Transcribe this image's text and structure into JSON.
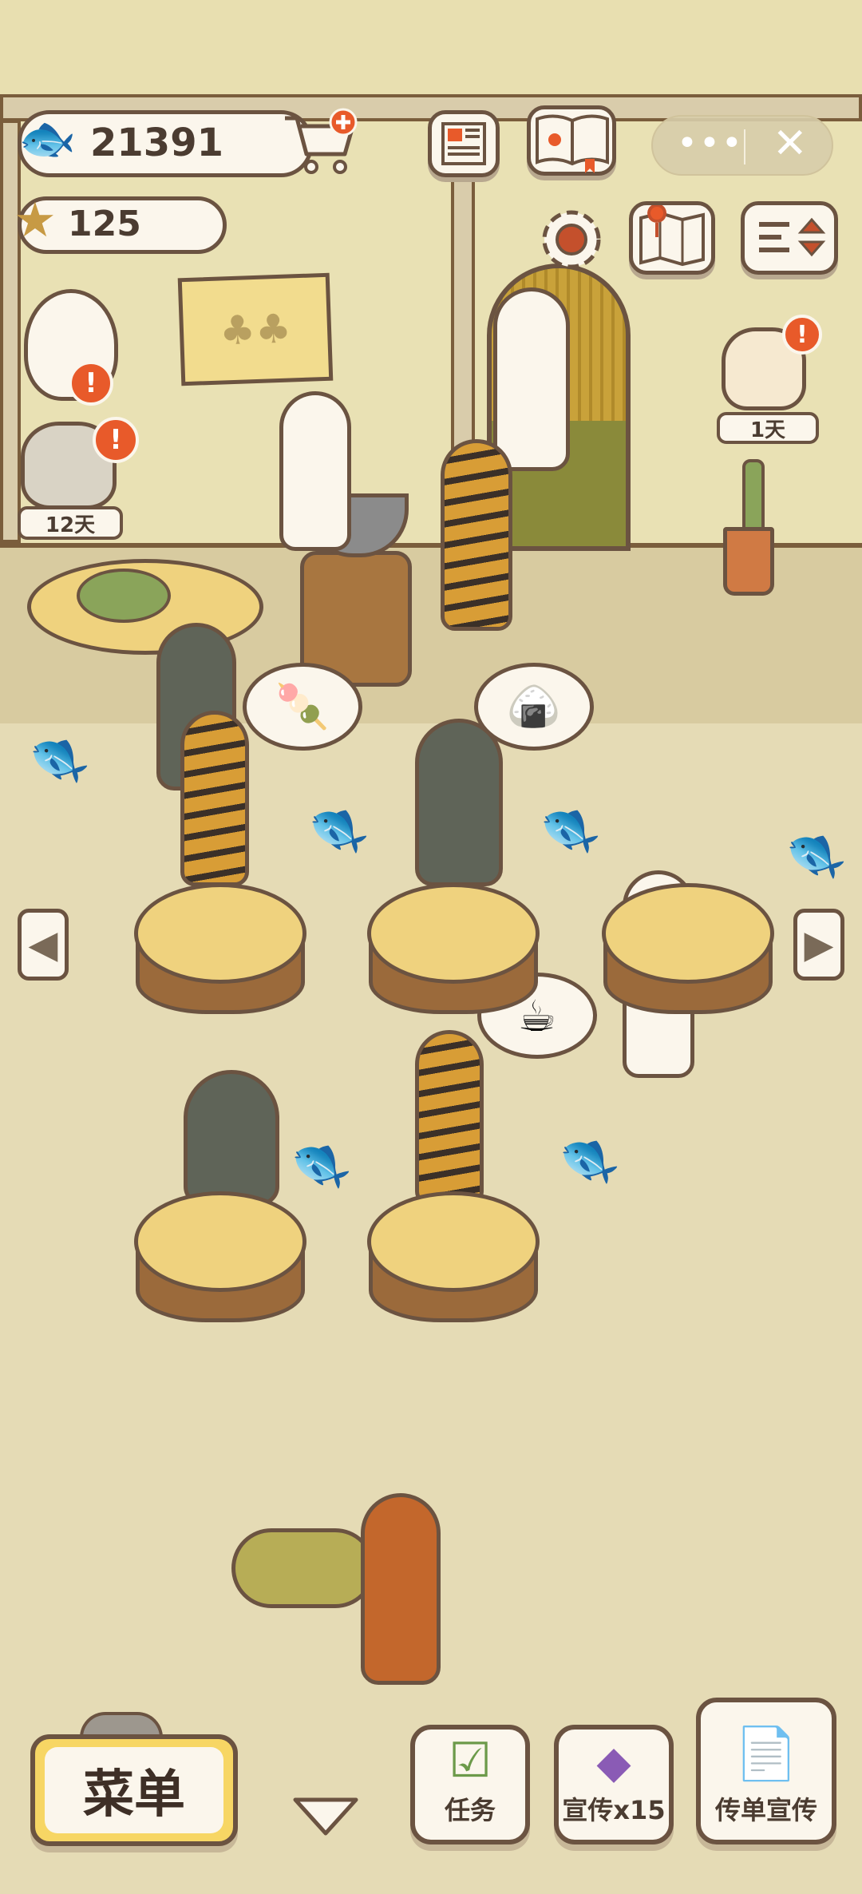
{
  "currency": {
    "fish_count": "21391",
    "star_count": "125"
  },
  "customers": {
    "panel_1_days": "12天",
    "panel_2_days": "1天",
    "alert": "!"
  },
  "bottom_bar": {
    "menu_label": "菜单",
    "tasks_label": "任务",
    "promote_label": "宣传x15",
    "flyer_label": "传单宣传"
  },
  "icons": {
    "fish": "fish-icon",
    "star": "star-icon",
    "cart": "cart-plus-icon",
    "news": "newspaper-icon",
    "book": "paw-book-icon",
    "settings": "gear-icon",
    "map": "map-icon",
    "sort": "sort-icon",
    "more": "more-icon",
    "close": "close-icon"
  },
  "colors": {
    "outline": "#6b5341",
    "panel": "#fbf6ec",
    "alert": "#e85a2a",
    "wood": "#efd27e"
  }
}
